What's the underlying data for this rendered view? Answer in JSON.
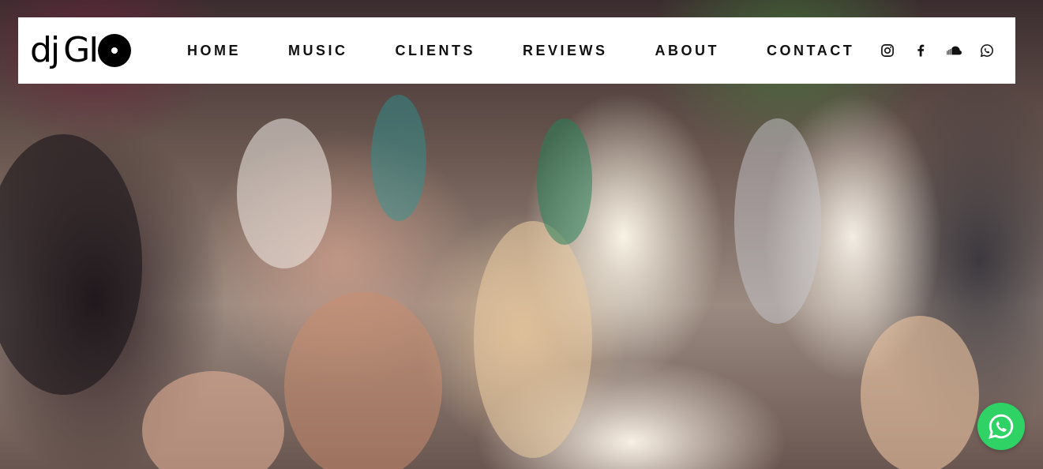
{
  "header": {
    "logo": {
      "text_dj": "dj",
      "text_gi": "GI",
      "icon": "vinyl-record-icon"
    },
    "nav": [
      {
        "label": "HOME"
      },
      {
        "label": "MUSIC"
      },
      {
        "label": "CLIENTS"
      },
      {
        "label": "REVIEWS"
      },
      {
        "label": "ABOUT"
      },
      {
        "label": "CONTACT"
      }
    ],
    "social": [
      {
        "icon": "instagram-icon"
      },
      {
        "icon": "facebook-icon"
      },
      {
        "icon": "soundcloud-icon"
      },
      {
        "icon": "whatsapp-icon"
      }
    ]
  },
  "hero": {
    "image": "wedding-dance-floor-photo"
  },
  "floating_button": {
    "icon": "whatsapp-icon",
    "color": "#2fd365"
  },
  "colors": {
    "header_bg": "#ffffff",
    "nav_text": "#111111"
  }
}
